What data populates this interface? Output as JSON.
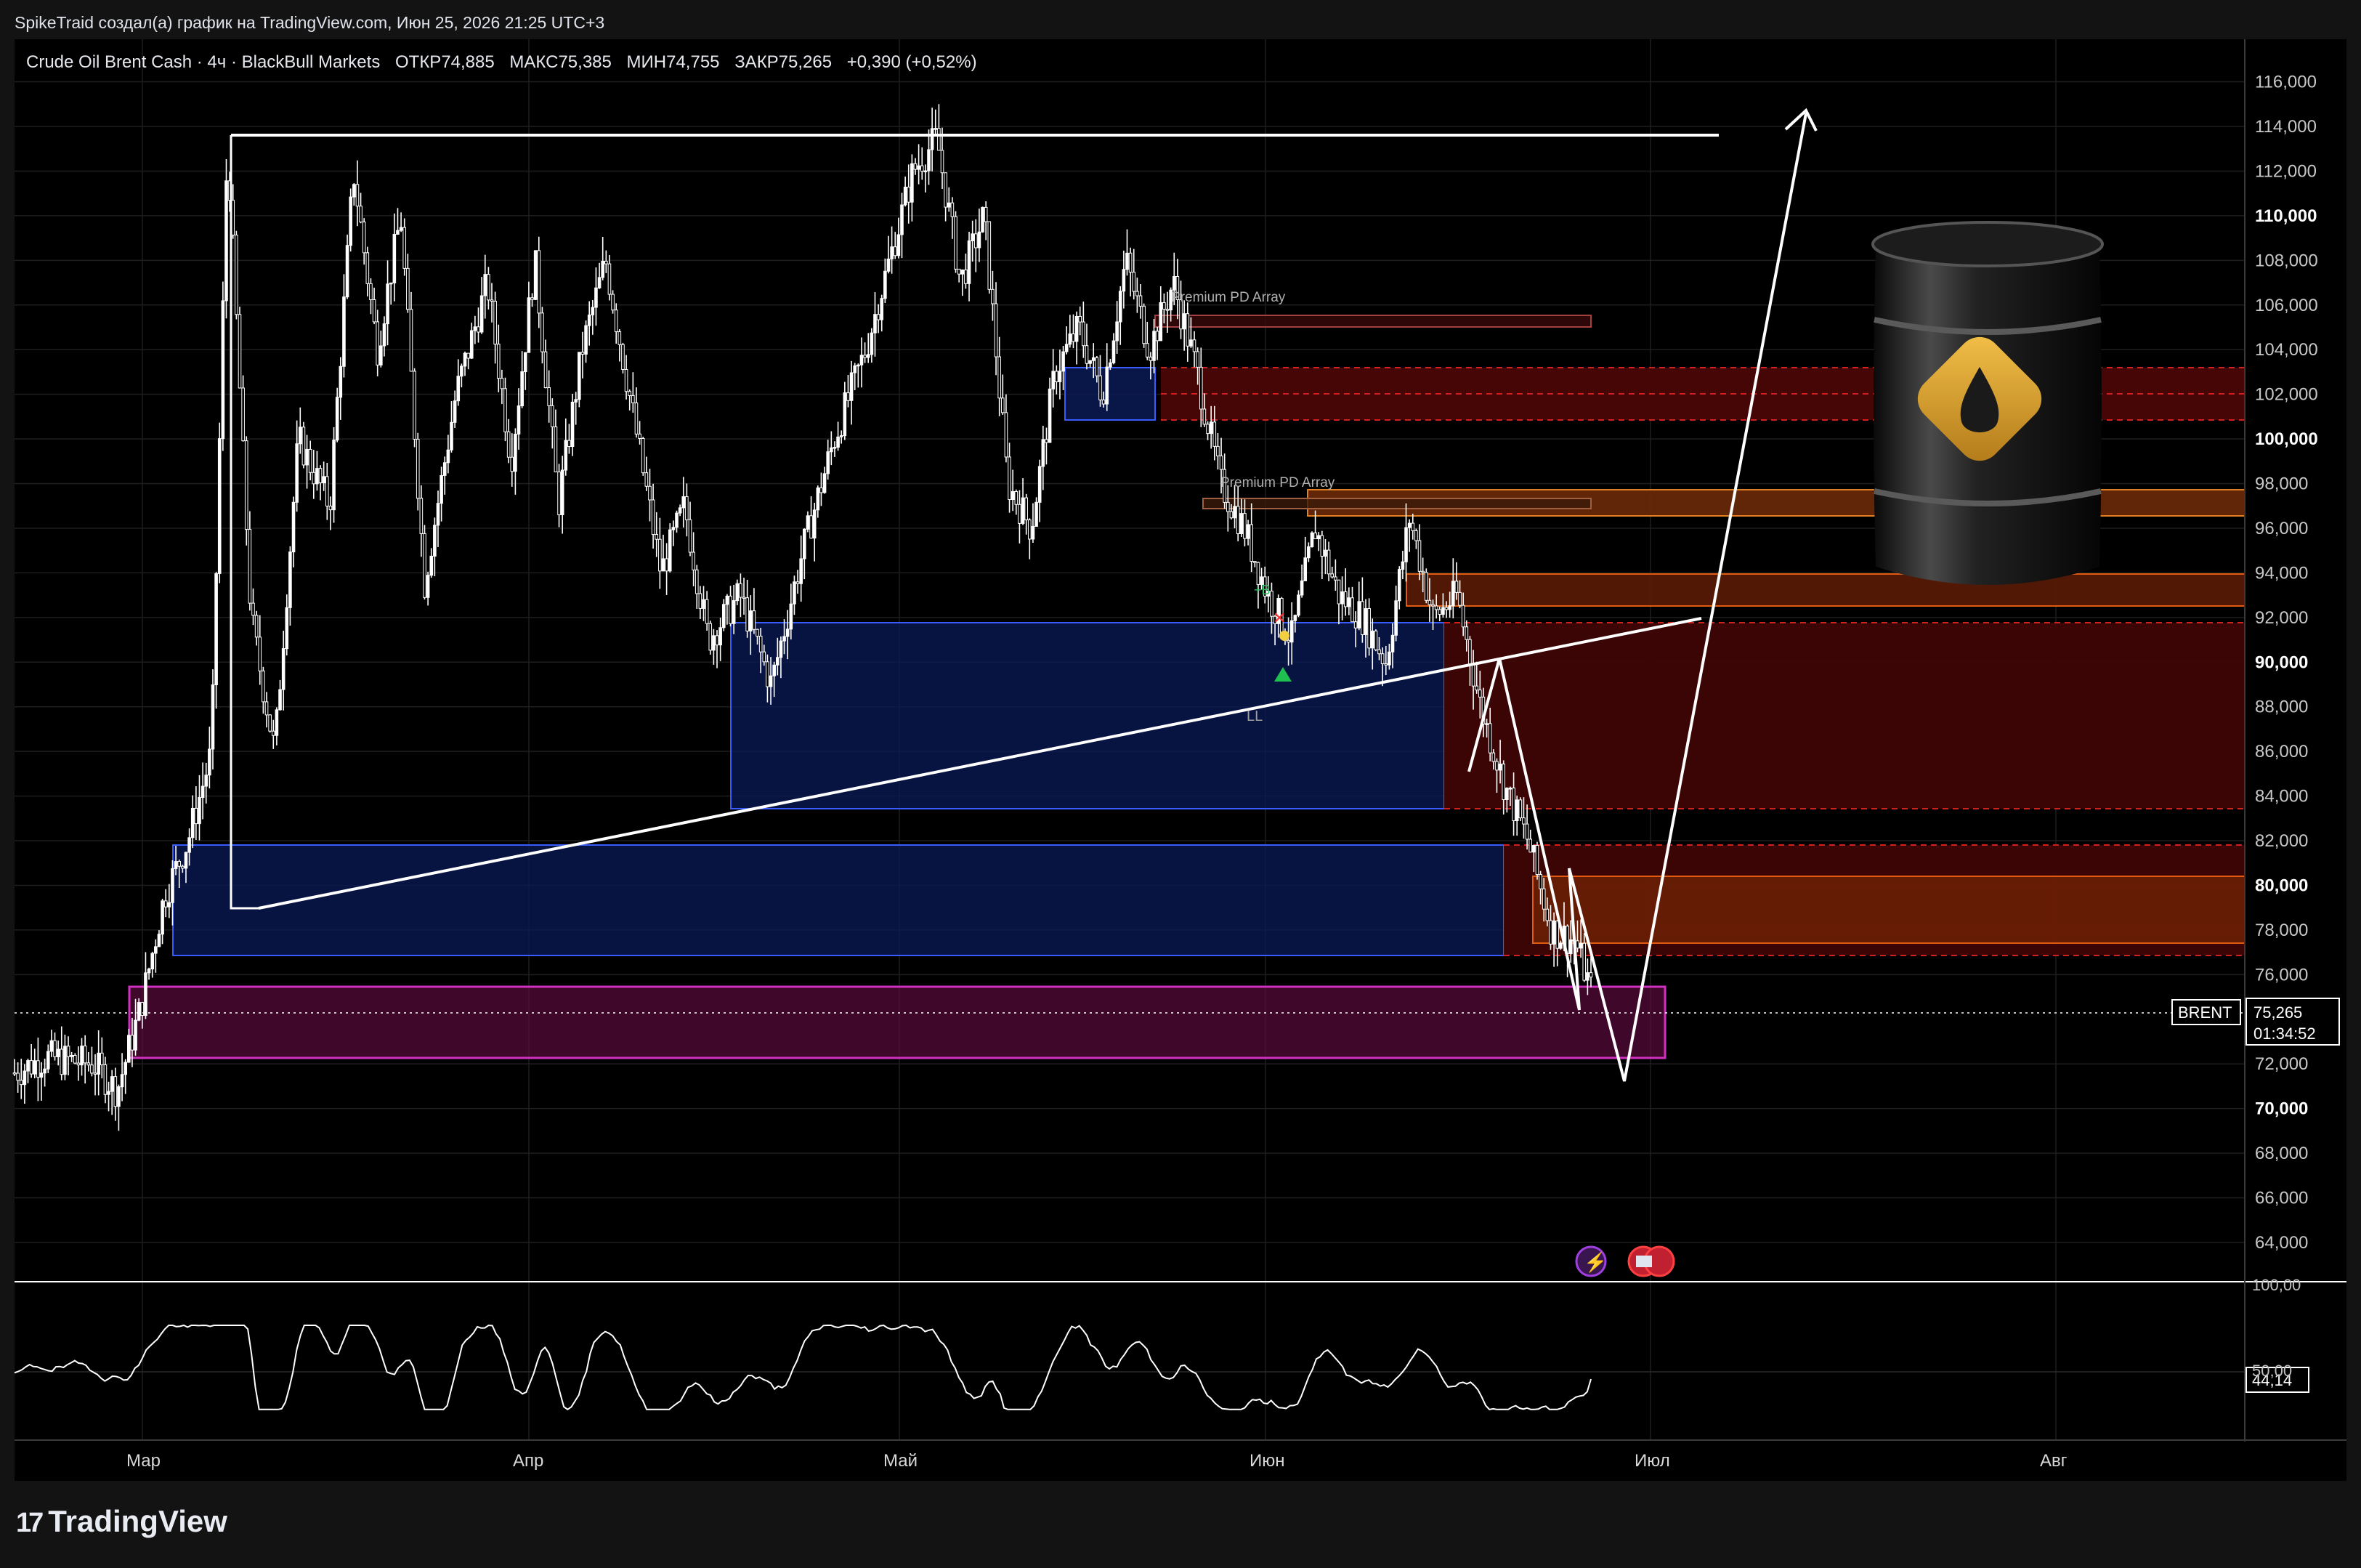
{
  "header": {
    "attribution": "SpikeTraid создал(а) график на TradingView.com, Июн 25, 2026 21:25 UTC+3"
  },
  "legend": {
    "symbol": "Crude Oil Brent Cash · 4ч · BlackBull Markets",
    "open": "ОТКР74,885",
    "high": "МАКС75,385",
    "low": "МИН74,755",
    "close": "ЗАКР75,265",
    "change": "+0,390 (+0,52%)"
  },
  "price_axis": {
    "ticks": [
      "116,000",
      "114,000",
      "112,000",
      "110,000",
      "108,000",
      "106,000",
      "104,000",
      "102,000",
      "100,000",
      "98,000",
      "96,000",
      "94,000",
      "92,000",
      "90,000",
      "88,000",
      "86,000",
      "84,000",
      "82,000",
      "80,000",
      "78,000",
      "76,000",
      "72,000",
      "70,000",
      "68,000",
      "66,000",
      "64,000"
    ],
    "bold_ticks": [
      "110,000",
      "100,000",
      "90,000",
      "80,000",
      "70,000"
    ],
    "current_symbol": "BRENT",
    "current_price": "75,265",
    "countdown": "01:34:52"
  },
  "rsi_axis": {
    "ticks": [
      "100,00",
      "50,00"
    ],
    "current_value": "44,14"
  },
  "time_axis": {
    "labels": [
      "Мар",
      "Апр",
      "Май",
      "Июн",
      "Июл",
      "Авг"
    ]
  },
  "annotations": {
    "premium_pd_1": "Premium PD Array",
    "premium_pd_2": "Premium PD Array",
    "ll_label": "LL",
    "entry_label": "+B"
  },
  "footer": {
    "brand": "TradingView",
    "logo_glyph": "17"
  },
  "colors": {
    "background": "#000000",
    "candles": "#ffffff",
    "blue_zone": "#1a2a7a",
    "red_zone": "#5a0a0a",
    "orange_zone": "#8a3a0a",
    "magenta_zone": "#b0208a",
    "price_line": "#ffffff"
  },
  "chart_data": {
    "type": "candlestick",
    "title": "Crude Oil Brent Cash · 4ч · BlackBull Markets",
    "ylim": [
      63,
      117
    ],
    "x_labels": [
      "Мар",
      "Апр",
      "Май",
      "Июн",
      "Июл",
      "Авг"
    ],
    "close_path": [
      [
        0,
        71.6
      ],
      [
        0.02,
        72.3
      ],
      [
        0.05,
        72.0
      ],
      [
        0.065,
        70.8
      ],
      [
        0.08,
        74.5
      ],
      [
        0.095,
        79.5
      ],
      [
        0.11,
        82.0
      ],
      [
        0.125,
        86.0
      ],
      [
        0.135,
        113.5
      ],
      [
        0.15,
        92.0
      ],
      [
        0.165,
        86.0
      ],
      [
        0.18,
        100.0
      ],
      [
        0.2,
        97.0
      ],
      [
        0.215,
        112.0
      ],
      [
        0.23,
        104.0
      ],
      [
        0.245,
        110.0
      ],
      [
        0.26,
        93.5
      ],
      [
        0.28,
        102.0
      ],
      [
        0.3,
        107.0
      ],
      [
        0.315,
        99.0
      ],
      [
        0.33,
        108.0
      ],
      [
        0.345,
        97.0
      ],
      [
        0.36,
        104.0
      ],
      [
        0.375,
        108.0
      ],
      [
        0.39,
        102.0
      ],
      [
        0.41,
        94.0
      ],
      [
        0.425,
        97.0
      ],
      [
        0.44,
        91.0
      ],
      [
        0.46,
        93.0
      ],
      [
        0.48,
        89.0
      ],
      [
        0.5,
        95.0
      ],
      [
        0.52,
        100.0
      ],
      [
        0.54,
        104.0
      ],
      [
        0.555,
        108.0
      ],
      [
        0.57,
        112.0
      ],
      [
        0.585,
        113.5
      ],
      [
        0.6,
        107.0
      ],
      [
        0.615,
        110.0
      ],
      [
        0.63,
        98.0
      ],
      [
        0.645,
        96.0
      ],
      [
        0.66,
        103.0
      ],
      [
        0.675,
        105.0
      ],
      [
        0.69,
        102.0
      ],
      [
        0.705,
        108.0
      ],
      [
        0.72,
        104.0
      ],
      [
        0.735,
        107.0
      ],
      [
        0.75,
        103.0
      ],
      [
        0.765,
        98.0
      ],
      [
        0.78,
        96.0
      ],
      [
        0.795,
        93.0
      ],
      [
        0.81,
        91.0
      ],
      [
        0.825,
        96.0
      ],
      [
        0.84,
        93.0
      ],
      [
        0.855,
        92.0
      ],
      [
        0.87,
        90.0
      ],
      [
        0.885,
        96.5
      ],
      [
        0.9,
        92.0
      ],
      [
        0.915,
        93.0
      ],
      [
        0.93,
        88.0
      ],
      [
        0.945,
        84.5
      ],
      [
        0.96,
        82.0
      ],
      [
        0.975,
        78.0
      ],
      [
        0.99,
        77.5
      ],
      [
        1.0,
        75.3
      ]
    ],
    "zones": [
      {
        "kind": "blue",
        "from": 77.8,
        "to": 82.6
      },
      {
        "kind": "blue",
        "from": 84.3,
        "to": 92.4
      },
      {
        "kind": "magenta",
        "from": 73.4,
        "to": 76.5
      },
      {
        "kind": "red",
        "from": 84.3,
        "to": 92.4
      },
      {
        "kind": "red",
        "from": 101.2,
        "to": 103.4
      },
      {
        "kind": "orange",
        "from": 78.2,
        "to": 81.0
      },
      {
        "kind": "orange",
        "from": 97.0,
        "to": 98.0
      },
      {
        "kind": "orange",
        "from": 93.0,
        "to": 94.3
      }
    ],
    "last_price": 75.265,
    "rsi_last": 44.14
  }
}
